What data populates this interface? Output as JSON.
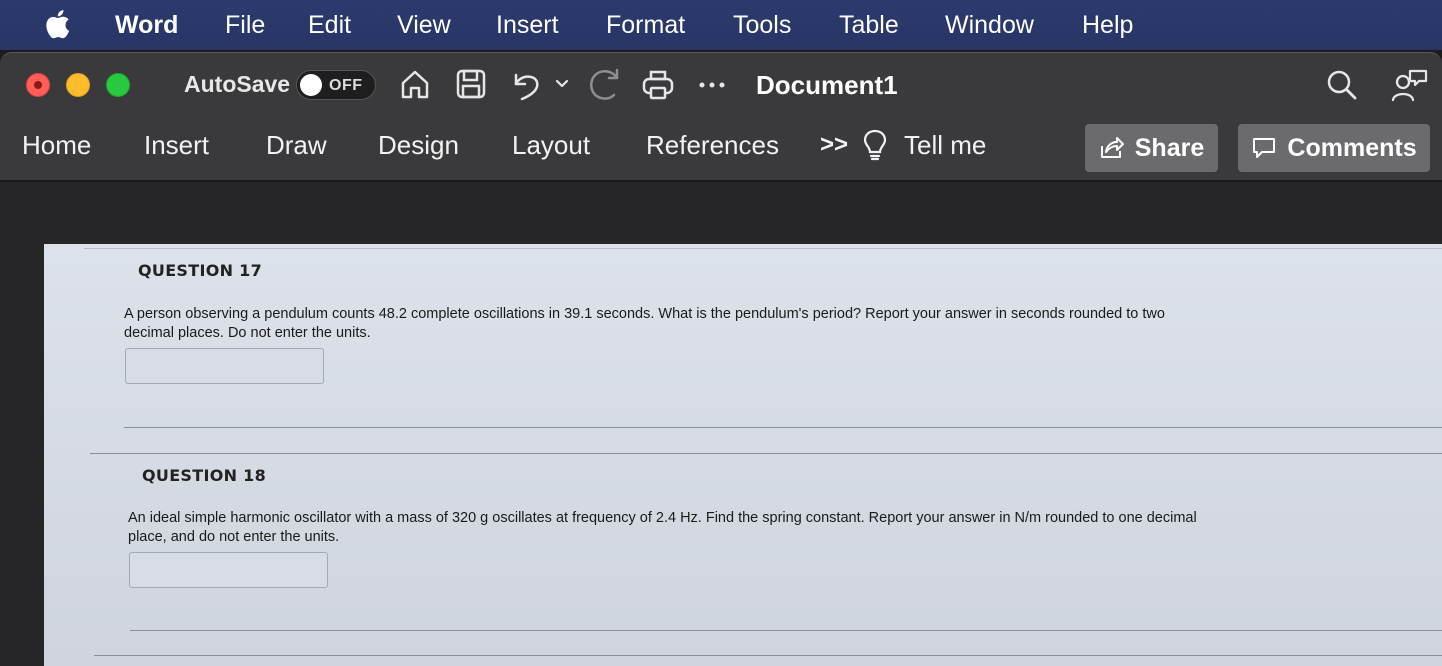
{
  "menubar": {
    "app": "Word",
    "items": [
      "File",
      "Edit",
      "View",
      "Insert",
      "Format",
      "Tools",
      "Table",
      "Window",
      "Help"
    ]
  },
  "titlebar": {
    "autosave_label": "AutoSave",
    "autosave_state": "OFF",
    "document_title": "Document1"
  },
  "ribbon": {
    "tabs": [
      "Home",
      "Insert",
      "Draw",
      "Design",
      "Layout",
      "References"
    ],
    "overflow": ">>",
    "tell_me": "Tell me",
    "share_label": "Share",
    "comments_label": "Comments"
  },
  "questions": [
    {
      "title": "QUESTION 17",
      "line1": "A person observing a pendulum counts 48.2 complete oscillations in 39.1 seconds. What is the pendulum's period? Report your answer in seconds rounded to two",
      "line2": "decimal places. Do not enter the units.",
      "answer": ""
    },
    {
      "title": "QUESTION 18",
      "line1": "An ideal simple harmonic oscillator with a mass of 320 g oscillates at frequency of 2.4 Hz. Find the spring constant. Report your answer in N/m rounded to one decimal",
      "line2": "place, and do not enter the units.",
      "answer": ""
    }
  ],
  "colors": {
    "menubar": "#2c3a6e",
    "titlebar": "#3a3a3c",
    "button": "#6b6b6e",
    "page": "#d8dde5"
  }
}
